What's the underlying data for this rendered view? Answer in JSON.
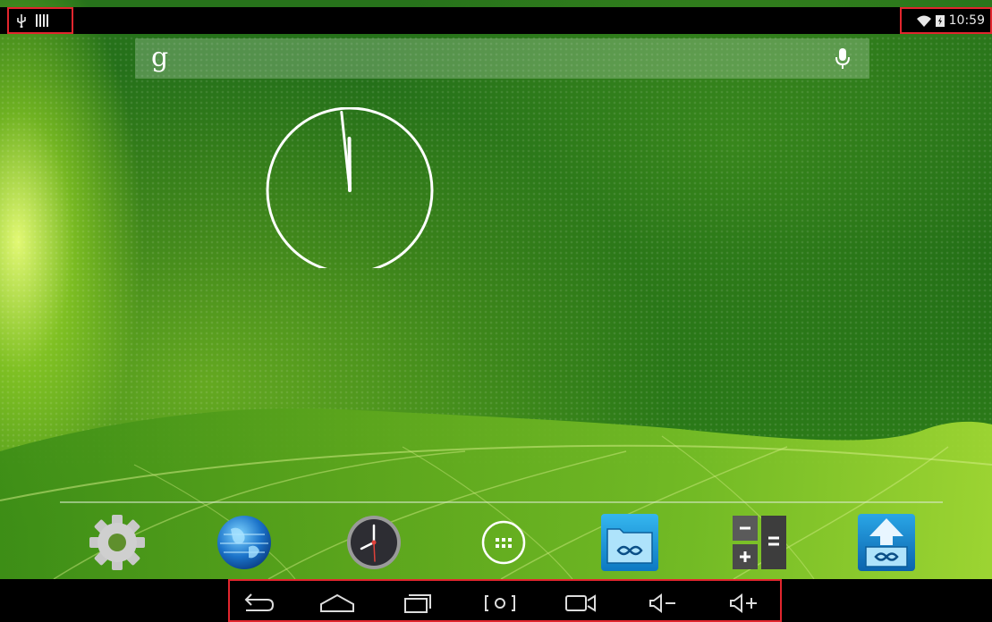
{
  "status_bar": {
    "left_icons": [
      "usb-icon",
      "signal-bars-icon"
    ],
    "right_icons": [
      "wifi-icon",
      "battery-charging-icon"
    ],
    "time": "10:59"
  },
  "search_bar": {
    "logo_text": "g",
    "icons": [
      "google-g-icon",
      "microphone-icon"
    ]
  },
  "clock_widget": {
    "hour": 11,
    "minute": 59,
    "icon": "analog-clock-icon"
  },
  "dock": {
    "apps": [
      {
        "icon": "settings-gear-icon"
      },
      {
        "icon": "browser-globe-icon"
      },
      {
        "icon": "clock-app-icon"
      },
      {
        "icon": "app-drawer-icon"
      },
      {
        "icon": "file-manager-icon"
      },
      {
        "icon": "calculator-icon"
      },
      {
        "icon": "upload-app-icon"
      }
    ]
  },
  "nav_bar": {
    "buttons": [
      "back-icon",
      "home-icon",
      "recent-apps-icon",
      "screenshot-icon",
      "screen-record-icon",
      "volume-down-icon",
      "volume-up-icon"
    ]
  },
  "colors": {
    "highlight_border": "#e2262e",
    "bar_background": "#000000",
    "wallpaper_green": "#27731b"
  }
}
